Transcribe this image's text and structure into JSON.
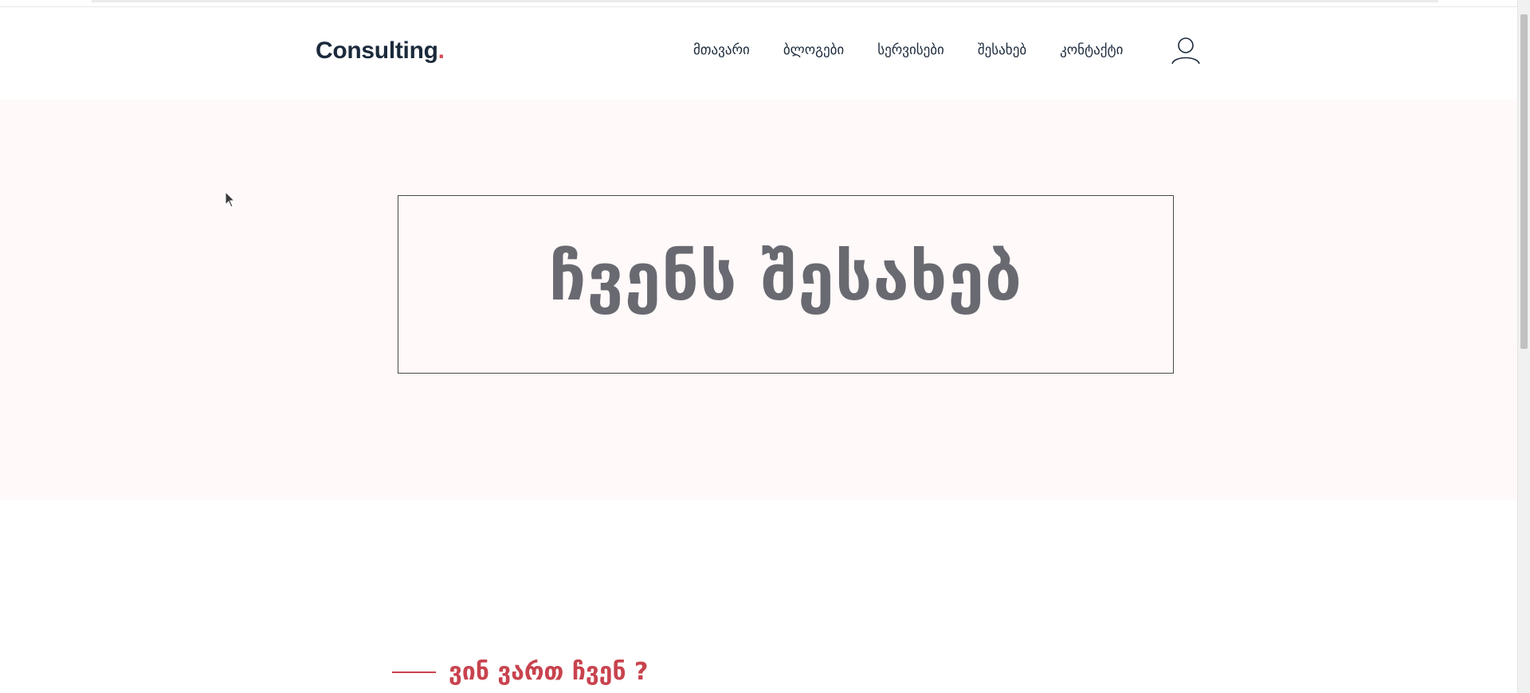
{
  "header": {
    "logo_text": "Consulting",
    "logo_dot": ".",
    "nav": [
      {
        "label": "მთავარი"
      },
      {
        "label": "ბლოგები"
      },
      {
        "label": "სერვისები"
      },
      {
        "label": "შესახებ"
      },
      {
        "label": "კონტაქტი"
      }
    ],
    "user_icon": "user-icon"
  },
  "hero": {
    "title": "ჩვენს შესახებ"
  },
  "who": {
    "title": "ვინ ვართ ჩვენ ?"
  },
  "colors": {
    "brand_dark": "#1b2a3b",
    "accent_red": "#c8434e",
    "hero_bg": "#fff9f9",
    "hero_text": "#696a71"
  }
}
